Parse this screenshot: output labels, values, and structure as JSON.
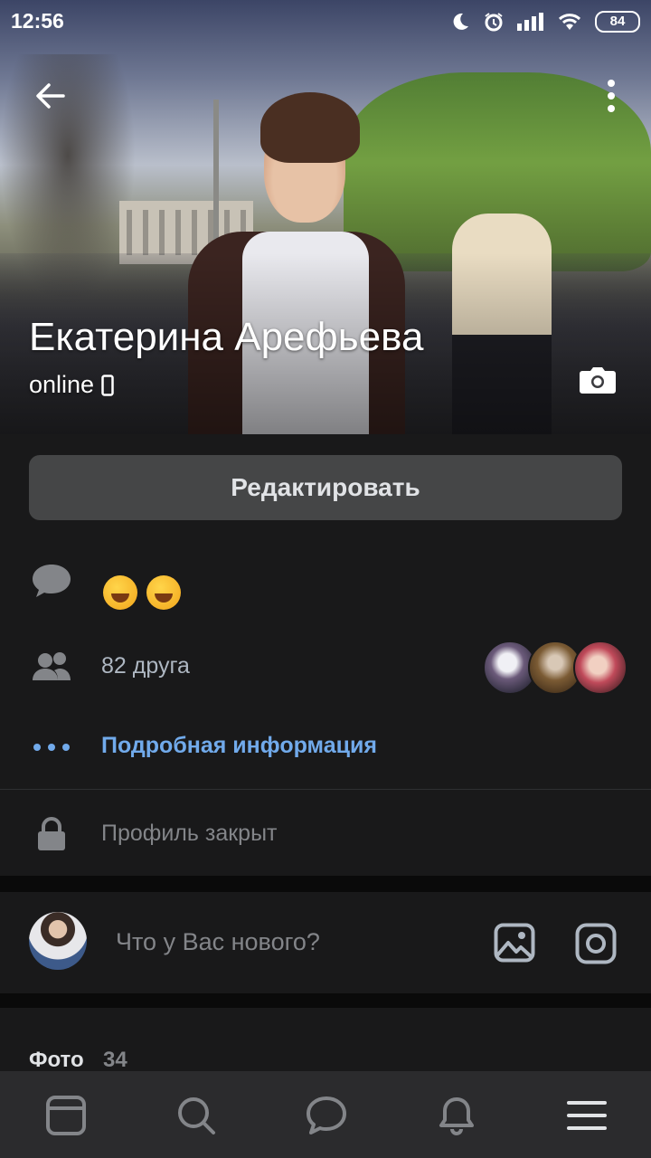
{
  "status_bar": {
    "time": "12:56",
    "battery": "84",
    "icons": [
      "moon-icon",
      "alarm-icon",
      "signal-icon",
      "wifi-icon",
      "battery-icon"
    ]
  },
  "profile": {
    "name": "Екатерина Арефьева",
    "status": "online",
    "edit_label": "Редактировать"
  },
  "details": {
    "status_message_emojis": [
      "😁",
      "😊"
    ],
    "friends_label": "82 друга",
    "more_info_label": "Подробная информация",
    "private_label": "Профиль закрыт"
  },
  "composer": {
    "placeholder": "Что у Вас нового?"
  },
  "photos": {
    "title": "Фото",
    "count": "34"
  },
  "tabbar": {
    "tabs": [
      "news-tab-icon",
      "search-tab-icon",
      "messages-tab-icon",
      "notifications-tab-icon",
      "menu-tab-icon"
    ]
  },
  "colors": {
    "background": "#19191a",
    "accent": "#71aaeb",
    "button": "#454647"
  }
}
